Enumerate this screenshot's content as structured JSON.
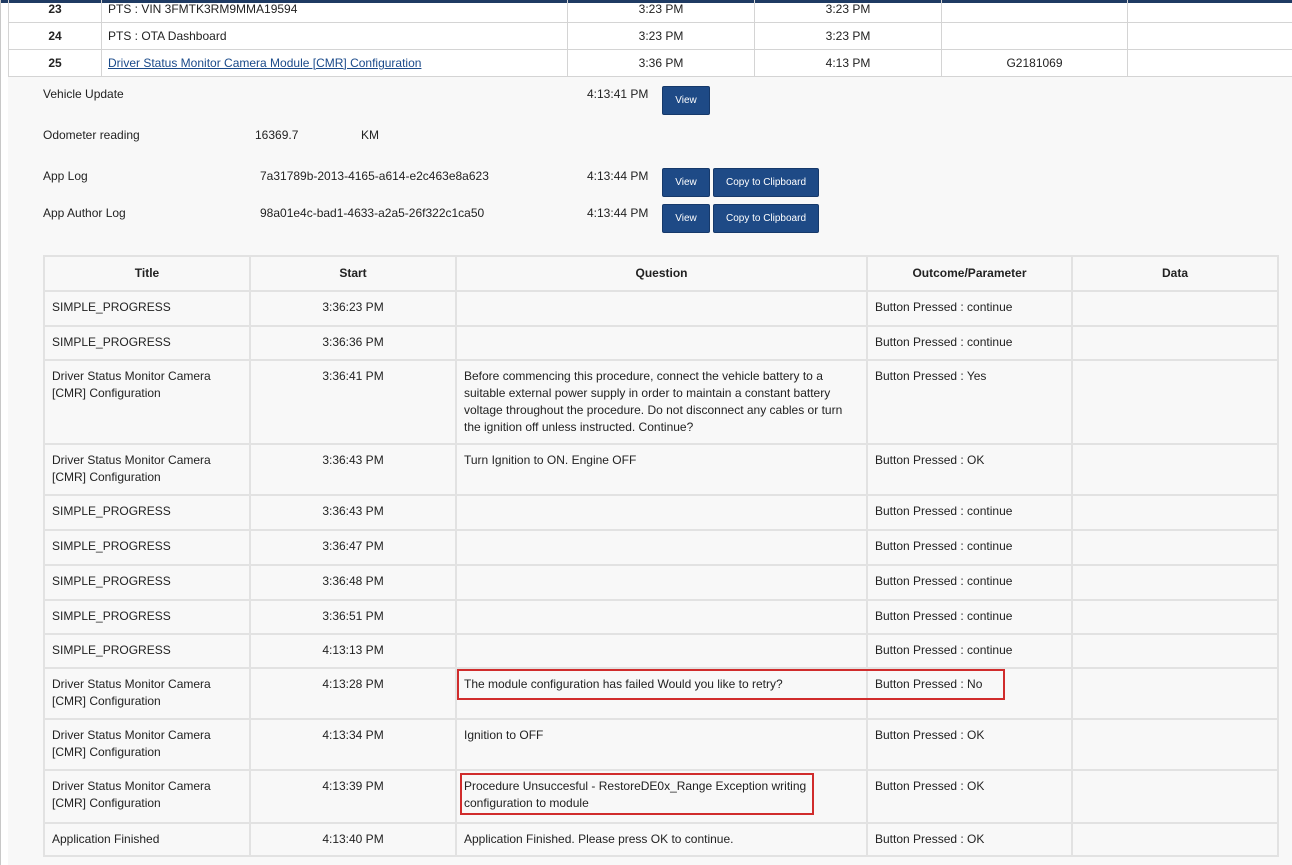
{
  "sessions": [
    {
      "num": "23",
      "name": "PTS : VIN 3FMTK3RM9MMA19594",
      "start": "3:23 PM",
      "end": "3:23 PM",
      "code": "",
      "link": false
    },
    {
      "num": "24",
      "name": "PTS : OTA Dashboard",
      "start": "3:23 PM",
      "end": "3:23 PM",
      "code": "",
      "link": false
    },
    {
      "num": "25",
      "name": "Driver Status Monitor Camera Module [CMR] Configuration",
      "start": "3:36 PM",
      "end": "4:13 PM",
      "code": "G2181069",
      "link": true
    }
  ],
  "details": {
    "vehicle_update": {
      "label": "Vehicle Update",
      "time": "4:13:41 PM",
      "view_label": "View"
    },
    "odometer": {
      "label": "Odometer reading",
      "value": "16369.7",
      "unit": "KM"
    },
    "app_log": {
      "label": "App Log",
      "id": "7a31789b-2013-4165-a614-e2c463e8a623",
      "time": "4:13:44 PM",
      "view_label": "View",
      "copy_label": "Copy to Clipboard"
    },
    "app_author_log": {
      "label": "App Author Log",
      "id": "98a01e4c-bad1-4633-a2a5-26f322c1ca50",
      "time": "4:13:44 PM",
      "view_label": "View",
      "copy_label": "Copy to Clipboard"
    }
  },
  "steps": {
    "headers": [
      "Title",
      "Start",
      "Question",
      "Outcome/Parameter",
      "Data"
    ],
    "rows": [
      {
        "title": "SIMPLE_PROGRESS",
        "start": "3:36:23 PM",
        "question": "",
        "outcome": "Button Pressed : continue",
        "data": ""
      },
      {
        "title": "SIMPLE_PROGRESS",
        "start": "3:36:36 PM",
        "question": "",
        "outcome": "Button Pressed : continue",
        "data": ""
      },
      {
        "title": "Driver Status Monitor Camera [CMR] Configuration",
        "start": "3:36:41 PM",
        "question": "Before commencing this procedure, connect the vehicle battery to a suitable external power supply in order to maintain a constant battery voltage throughout the procedure. Do not disconnect any cables or turn the ignition off unless instructed. Continue?",
        "outcome": "Button Pressed : Yes",
        "data": ""
      },
      {
        "title": "Driver Status Monitor Camera [CMR] Configuration",
        "start": "3:36:43 PM",
        "question": "Turn Ignition to ON. Engine OFF",
        "outcome": "Button Pressed : OK",
        "data": ""
      },
      {
        "title": "SIMPLE_PROGRESS",
        "start": "3:36:43 PM",
        "question": "",
        "outcome": "Button Pressed : continue",
        "data": ""
      },
      {
        "title": "SIMPLE_PROGRESS",
        "start": "3:36:47 PM",
        "question": "",
        "outcome": "Button Pressed : continue",
        "data": ""
      },
      {
        "title": "SIMPLE_PROGRESS",
        "start": "3:36:48 PM",
        "question": "",
        "outcome": "Button Pressed : continue",
        "data": ""
      },
      {
        "title": "SIMPLE_PROGRESS",
        "start": "3:36:51 PM",
        "question": "",
        "outcome": "Button Pressed : continue",
        "data": ""
      },
      {
        "title": "SIMPLE_PROGRESS",
        "start": "4:13:13 PM",
        "question": "",
        "outcome": "Button Pressed : continue",
        "data": ""
      },
      {
        "title": "Driver Status Monitor Camera [CMR] Configuration",
        "start": "4:13:28 PM",
        "question": "The module configuration has failed Would you like to retry?",
        "outcome": "Button Pressed : No",
        "data": ""
      },
      {
        "title": "Driver Status Monitor Camera [CMR] Configuration",
        "start": "4:13:34 PM",
        "question": "Ignition to OFF",
        "outcome": "Button Pressed : OK",
        "data": ""
      },
      {
        "title": "Driver Status Monitor Camera [CMR] Configuration",
        "start": "4:13:39 PM",
        "question": "Procedure Unsuccesful - RestoreDE0x_Range Exception writing configuration to module",
        "outcome": "Button Pressed : OK",
        "data": ""
      },
      {
        "title": "Application Finished",
        "start": "4:13:40 PM",
        "question": "Application Finished. Please press OK to continue.",
        "outcome": "Button Pressed : OK",
        "data": ""
      }
    ]
  },
  "colors": {
    "button": "#1e4a86",
    "highlight": "#d02c2c",
    "topbar": "#1f3b63"
  }
}
